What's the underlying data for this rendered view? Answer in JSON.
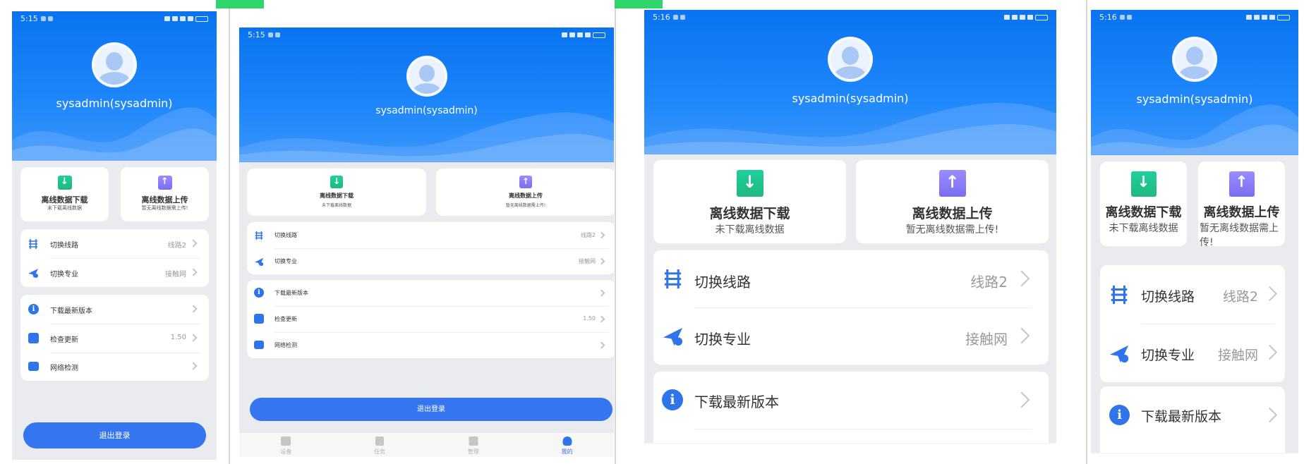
{
  "status": {
    "time_a": "5:15",
    "time_b": "5:16"
  },
  "profile": {
    "username": "sysadmin(sysadmin)"
  },
  "offline": {
    "download_title": "离线数据下载",
    "download_sub": "未下载离线数据",
    "upload_title": "离线数据上传",
    "upload_sub": "暂无离线数据需上传!"
  },
  "settings": {
    "line_label": "切换线路",
    "line_value": "线路2",
    "spec_label": "切换专业",
    "spec_value": "接触网",
    "download_version": "下载最新版本",
    "check_update": "检查更新",
    "version": "1.50",
    "network_check": "网络检测"
  },
  "logout_label": "退出登录",
  "tabs": [
    "设备",
    "任务",
    "管理",
    "我的"
  ],
  "icons": {
    "download": "arrow-down-icon",
    "upload": "arrow-up-icon",
    "line": "railway-icon",
    "spec": "plane-gear-icon",
    "info": "info-icon",
    "refresh": "refresh-icon",
    "network": "dots-icon"
  },
  "colors": {
    "primary": "#2f74ea",
    "download_green": "#21b87e",
    "upload_purple": "#7a6df2",
    "header_blue": "#0a73f0"
  }
}
